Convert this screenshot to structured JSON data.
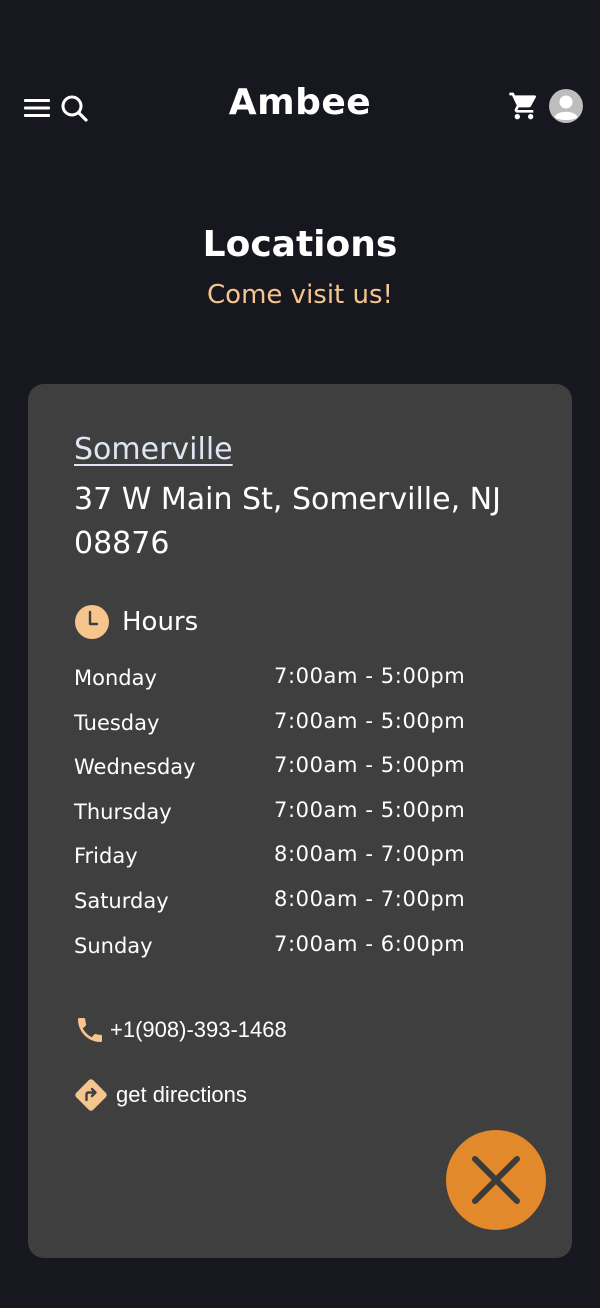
{
  "app": {
    "title": "Ambee"
  },
  "header": {
    "menu_icon": "hamburger-menu-icon",
    "search_icon": "search-icon",
    "cart_icon": "shopping-cart-icon",
    "avatar_icon": "user-avatar-icon"
  },
  "page": {
    "title": "Locations",
    "subtitle": "Come visit us!"
  },
  "location": {
    "name": "Somerville",
    "address": "37 W Main St, Somerville, NJ 08876",
    "hours_label": "Hours",
    "hours": [
      {
        "day": "Monday",
        "time": "7:00am - 5:00pm"
      },
      {
        "day": "Tuesday",
        "time": "7:00am - 5:00pm"
      },
      {
        "day": "Wednesday",
        "time": "7:00am - 5:00pm"
      },
      {
        "day": "Thursday",
        "time": "7:00am - 5:00pm"
      },
      {
        "day": "Friday",
        "time": "8:00am - 7:00pm"
      },
      {
        "day": "Saturday",
        "time": "8:00am - 7:00pm"
      },
      {
        "day": "Sunday",
        "time": "7:00am - 6:00pm"
      }
    ],
    "phone": "+1(908)-393-1468",
    "directions_label": "get directions"
  },
  "colors": {
    "background": "#171720",
    "card": "#3f3f3f",
    "accent": "#f5c58d",
    "close_button": "#e28a2b"
  }
}
